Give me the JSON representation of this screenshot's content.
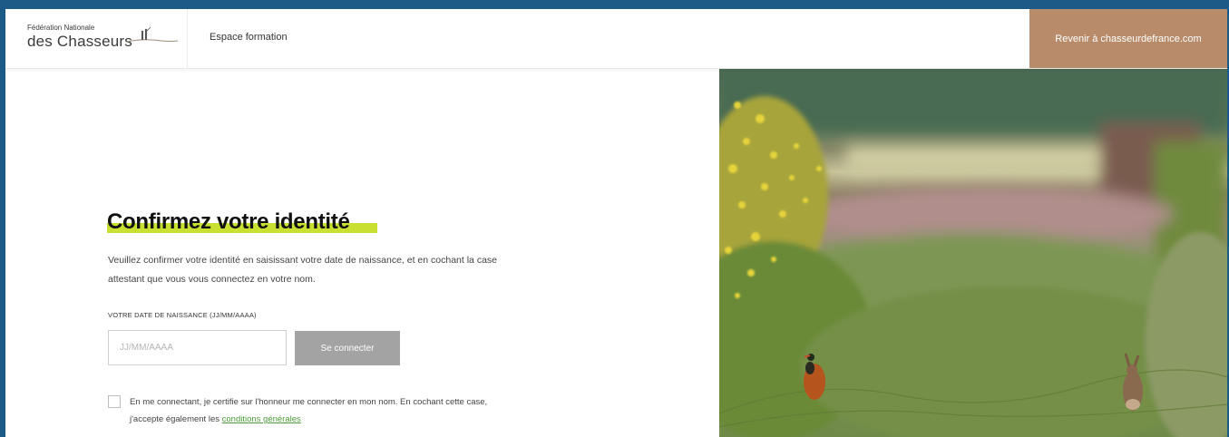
{
  "header": {
    "logo_top": "Fédération Nationale",
    "logo_bottom": "des Chasseurs",
    "nav_link": "Espace formation",
    "back_button": "Revenir à chasseurdefrance.com"
  },
  "form": {
    "title": "Confirmez votre identité",
    "intro_line1": "Veuillez confirmer votre identité en saisissant votre date de naissance, et en cochant la case",
    "intro_line2": "attestant que vous vous connectez en votre nom.",
    "dob_label": "VOTRE DATE DE NAISSANCE (JJ/MM/AAAA)",
    "dob_placeholder": "JJ/MM/AAAA",
    "dob_value": "",
    "connect_button": "Se connecter",
    "consent_line1": "En me connectant, je certifie sur l'honneur me connecter en mon nom. En cochant cette case,",
    "consent_line2_prefix": "j'accepte également les ",
    "consent_link": "conditions générales",
    "consent_checked": false
  },
  "colors": {
    "accent_highlight": "#c9e032",
    "back_button_bg": "#b88b6a",
    "link": "#4d9a3a",
    "frame_border": "#1e5a88"
  },
  "icons": {
    "logo_mark": "hunters-silhouette-icon"
  }
}
